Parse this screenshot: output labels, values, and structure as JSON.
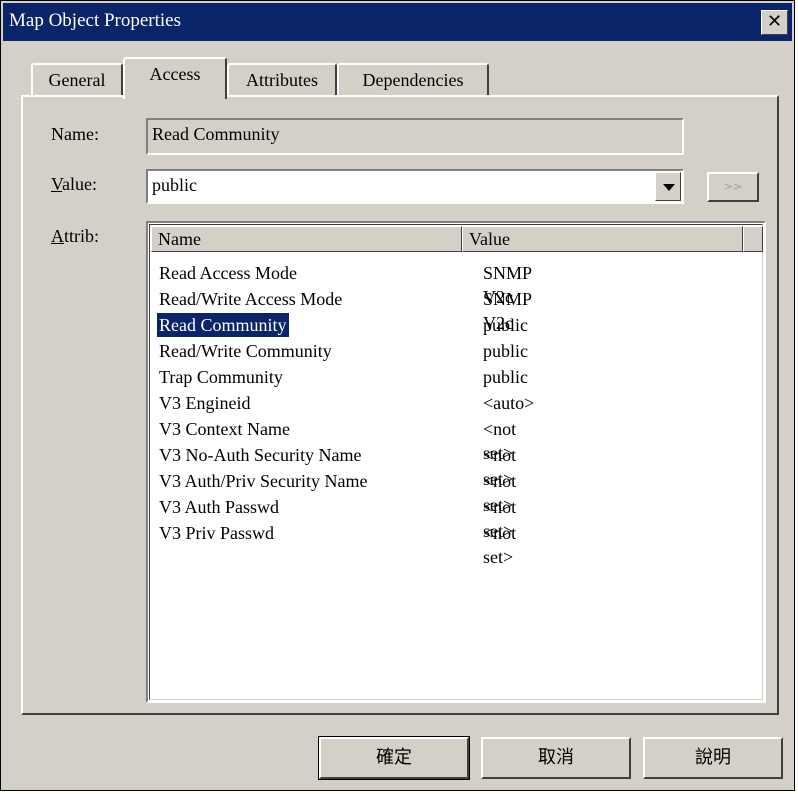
{
  "window": {
    "title": "Map Object Properties",
    "close_label": "✕"
  },
  "tabs": [
    {
      "label": "General"
    },
    {
      "label": "Access"
    },
    {
      "label": "Attributes"
    },
    {
      "label": "Dependencies"
    }
  ],
  "form": {
    "name_label": "Name:",
    "name_value": "Read Community",
    "value_label_u": "V",
    "value_label_rest": "alue:",
    "value_value": "public",
    "more_label": ">>",
    "attrib_label_u": "A",
    "attrib_label_rest": "ttrib:"
  },
  "list": {
    "columns": [
      "Name",
      "Value"
    ],
    "rows": [
      {
        "name": "Read Access Mode",
        "value": "SNMP V2c"
      },
      {
        "name": "Read/Write Access Mode",
        "value": "SNMP V2c"
      },
      {
        "name": "Read Community",
        "value": "public",
        "selected": true
      },
      {
        "name": "Read/Write Community",
        "value": "public"
      },
      {
        "name": "Trap Community",
        "value": "public"
      },
      {
        "name": "V3 Engineid",
        "value": "<auto>"
      },
      {
        "name": "V3 Context Name",
        "value": "<not set>"
      },
      {
        "name": "V3 No-Auth Security Name",
        "value": "<not set>"
      },
      {
        "name": "V3 Auth/Priv Security Name",
        "value": "<not set>"
      },
      {
        "name": "V3 Auth Passwd",
        "value": "<not set>"
      },
      {
        "name": "V3 Priv Passwd",
        "value": "<not set>"
      }
    ]
  },
  "buttons": {
    "ok": "確定",
    "cancel": "取消",
    "help": "說明"
  },
  "colors": {
    "titlebar": "#0a246a",
    "face": "#d4d0c8",
    "selection": "#0a246a"
  }
}
